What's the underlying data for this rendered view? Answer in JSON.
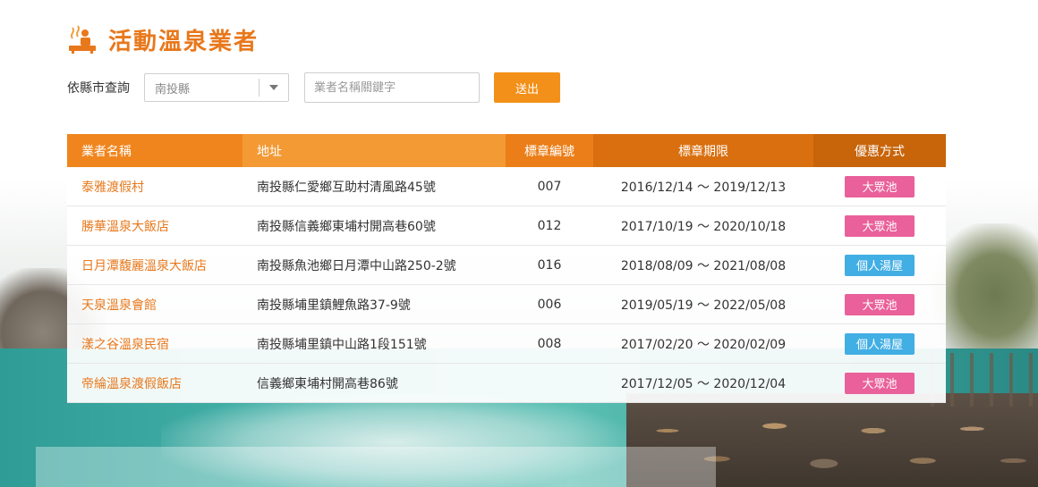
{
  "header": {
    "title": "活動溫泉業者",
    "icon": "hot-spring-person-icon"
  },
  "filter": {
    "label": "依縣市查詢",
    "county_value": "南投縣",
    "keyword_placeholder": "業者名稱關鍵字",
    "submit_label": "送出"
  },
  "table": {
    "headers": [
      "業者名稱",
      "地址",
      "標章編號",
      "標章期限",
      "優惠方式"
    ],
    "header_colors": [
      "#f0851d",
      "#f39a35",
      "#eb7e18",
      "#d96f0e",
      "#c8640a"
    ],
    "rows": [
      {
        "name": "泰雅渡假村",
        "address": "南投縣仁愛鄉互助村清風路45號",
        "number": "007",
        "period": "2016/12/14 ～ 2019/12/13",
        "type": "大眾池",
        "type_color": "#e9609a"
      },
      {
        "name": "勝華溫泉大飯店",
        "address": "南投縣信義鄉東埔村開高巷60號",
        "number": "012",
        "period": "2017/10/19 ～ 2020/10/18",
        "type": "大眾池",
        "type_color": "#e9609a"
      },
      {
        "name": "日月潭馥麗溫泉大飯店",
        "address": "南投縣魚池鄉日月潭中山路250-2號",
        "number": "016",
        "period": "2018/08/09 ～ 2021/08/08",
        "type": "個人湯屋",
        "type_color": "#41aee4"
      },
      {
        "name": "天泉溫泉會館",
        "address": "南投縣埔里鎮鯉魚路37-9號",
        "number": "006",
        "period": "2019/05/19 ～ 2022/05/08",
        "type": "大眾池",
        "type_color": "#e9609a"
      },
      {
        "name": "漾之谷溫泉民宿",
        "address": "南投縣埔里鎮中山路1段151號",
        "number": "008",
        "period": "2017/02/20 ～ 2020/02/09",
        "type": "個人湯屋",
        "type_color": "#41aee4"
      },
      {
        "name": "帝綸溫泉渡假飯店",
        "address": "信義鄉東埔村開高巷86號",
        "number": "",
        "period": "2017/12/05 ～ 2020/12/04",
        "type": "大眾池",
        "type_color": "#e9609a"
      }
    ]
  }
}
